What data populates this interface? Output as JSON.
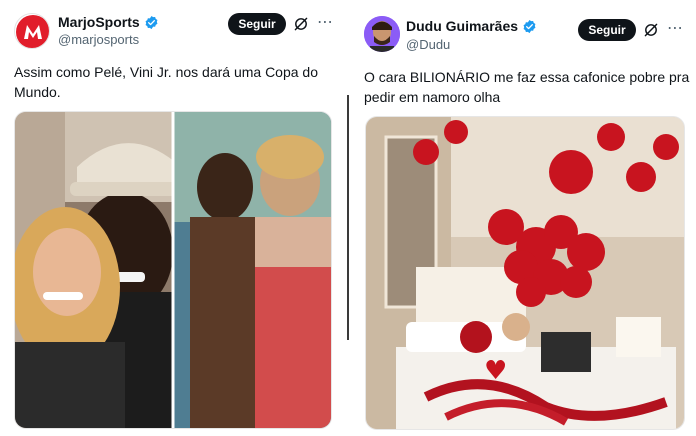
{
  "tweets": [
    {
      "author": {
        "display_name": "MarjoSports",
        "handle": "@marjosports",
        "avatar_letter": "M"
      },
      "follow_label": "Seguir",
      "text": "Assim como Pelé, Vini Jr. nos dará uma Copa do Mundo.",
      "media_description": "side-by-side photos of couples"
    },
    {
      "author": {
        "display_name": "Dudu Guimarães",
        "handle": "@Dudu"
      },
      "follow_label": "Seguir",
      "text": "O cara BILIONÁRIO me faz essa cafonice pobre pra pedir em namoro olha",
      "media_description": "hotel room decorated with red heart balloons and rose petals"
    }
  ],
  "colors": {
    "follow_bg": "#0f1419",
    "verified": "#1d9bf0",
    "handle": "#536471",
    "brand_red": "#e11d2a"
  },
  "icons": {
    "verified": "verified-badge-icon",
    "grok": "grok-icon",
    "more": "more-icon"
  },
  "more_glyph": "⋯"
}
